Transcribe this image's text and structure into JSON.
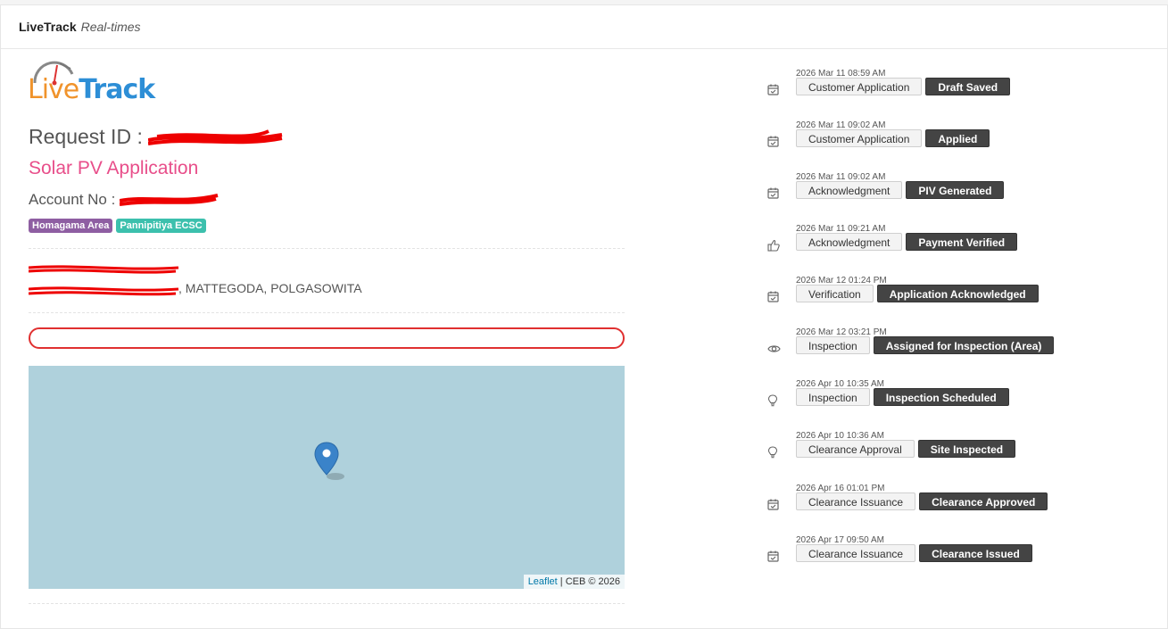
{
  "header": {
    "brand": "LiveTrack",
    "subtitle": "Real-times"
  },
  "logo": {
    "part1": "Live",
    "part2": "Track"
  },
  "request": {
    "id_label": "Request ID : ",
    "app_type": "Solar PV Application",
    "account_label": "Account No : "
  },
  "badges": [
    {
      "label": "Homagama Area",
      "color": "#8e5ea2"
    },
    {
      "label": "Pannipitiya ECSC",
      "color": "#3cc0ad"
    }
  ],
  "address": {
    "suffix": ", MATTEGODA, POLGASOWITA"
  },
  "map": {
    "attrib_link": "Leaflet",
    "attrib_text": " | CEB © 2026"
  },
  "timeline": [
    {
      "time": "2026 Mar 11 08:59 AM",
      "stage": "Customer Application",
      "status": "Draft Saved",
      "icon": "calendar-check-icon"
    },
    {
      "time": "2026 Mar 11 09:02 AM",
      "stage": "Customer Application",
      "status": "Applied",
      "icon": "calendar-check-icon"
    },
    {
      "time": "2026 Mar 11 09:02 AM",
      "stage": "Acknowledgment",
      "status": "PIV Generated",
      "icon": "calendar-check-icon"
    },
    {
      "time": "2026 Mar 11 09:21 AM",
      "stage": "Acknowledgment",
      "status": "Payment Verified",
      "icon": "thumbs-up-icon"
    },
    {
      "time": "2026 Mar 12 01:24 PM",
      "stage": "Verification",
      "status": "Application Acknowledged",
      "icon": "calendar-check-icon"
    },
    {
      "time": "2026 Mar 12 03:21 PM",
      "stage": "Inspection",
      "status": "Assigned for Inspection (Area)",
      "icon": "eye-icon"
    },
    {
      "time": "2026 Apr 10 10:35 AM",
      "stage": "Inspection",
      "status": "Inspection Scheduled",
      "icon": "lightbulb-icon"
    },
    {
      "time": "2026 Apr 10 10:36 AM",
      "stage": "Clearance Approval",
      "status": "Site Inspected",
      "icon": "lightbulb-icon"
    },
    {
      "time": "2026 Apr 16 01:01 PM",
      "stage": "Clearance Issuance",
      "status": "Clearance Approved",
      "icon": "calendar-check-icon"
    },
    {
      "time": "2026 Apr 17 09:50 AM",
      "stage": "Clearance Issuance",
      "status": "Clearance Issued",
      "icon": "calendar-check-icon"
    }
  ]
}
